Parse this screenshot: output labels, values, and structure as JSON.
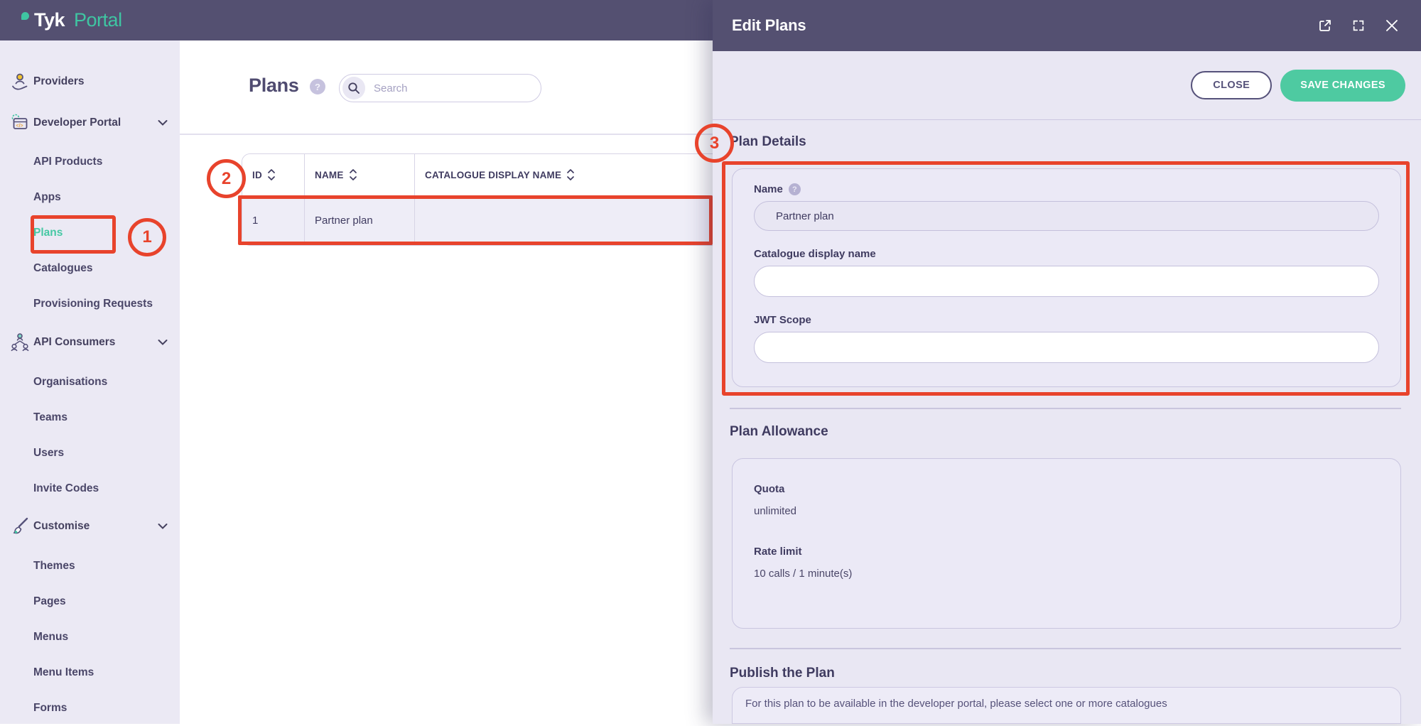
{
  "brand": {
    "name_primary": "Tyk",
    "name_secondary": "Portal"
  },
  "sidebar": {
    "items": [
      {
        "label": "Providers",
        "type": "section",
        "icon": "providers-icon"
      },
      {
        "label": "Developer Portal",
        "type": "section",
        "icon": "developer-portal-icon",
        "expanded": true
      },
      {
        "label": "API Products",
        "type": "child"
      },
      {
        "label": "Apps",
        "type": "child"
      },
      {
        "label": "Plans",
        "type": "child",
        "selected": true
      },
      {
        "label": "Catalogues",
        "type": "child"
      },
      {
        "label": "Provisioning Requests",
        "type": "child"
      },
      {
        "label": "API Consumers",
        "type": "section",
        "icon": "api-consumers-icon",
        "expanded": true
      },
      {
        "label": "Organisations",
        "type": "child"
      },
      {
        "label": "Teams",
        "type": "child"
      },
      {
        "label": "Users",
        "type": "child"
      },
      {
        "label": "Invite Codes",
        "type": "child"
      },
      {
        "label": "Customise",
        "type": "section",
        "icon": "customise-icon",
        "expanded": true
      },
      {
        "label": "Themes",
        "type": "child"
      },
      {
        "label": "Pages",
        "type": "child"
      },
      {
        "label": "Menus",
        "type": "child"
      },
      {
        "label": "Menu Items",
        "type": "child"
      },
      {
        "label": "Forms",
        "type": "child"
      }
    ]
  },
  "main": {
    "title": "Plans",
    "title_help": "?",
    "search": {
      "placeholder": "Search",
      "value": ""
    },
    "table": {
      "columns": [
        "ID",
        "NAME",
        "CATALOGUE DISPLAY NAME"
      ],
      "rows": [
        {
          "id": "1",
          "name": "Partner plan",
          "catalogue_display_name": ""
        }
      ]
    }
  },
  "drawer": {
    "title": "Edit Plans",
    "header_icons": [
      "open-in-new-window-icon",
      "fullscreen-icon",
      "close-icon"
    ],
    "buttons": {
      "close": "CLOSE",
      "save": "SAVE CHANGES"
    },
    "plan_details": {
      "heading": "Plan Details",
      "name_label": "Name",
      "name_help": "?",
      "name_value": "Partner plan",
      "catalogue_display_name_label": "Catalogue display name",
      "catalogue_display_name_value": "",
      "jwt_scope_label": "JWT Scope",
      "jwt_scope_value": ""
    },
    "plan_allowance": {
      "heading": "Plan Allowance",
      "quota_label": "Quota",
      "quota_value": "unlimited",
      "rate_limit_label": "Rate limit",
      "rate_limit_value": "10 calls / 1 minute(s)"
    },
    "publish": {
      "heading": "Publish the Plan",
      "description": "For this plan to be available in the developer portal, please select one or more catalogues"
    }
  },
  "annotations": {
    "step1": "1",
    "step2": "2",
    "step3": "3"
  },
  "colors": {
    "topbar": "#545071",
    "sidebar_bg": "#ebe9f4",
    "accent_teal": "#3fc5a2",
    "save_button": "#4ecaa1",
    "annotation_red": "#e8432c",
    "drawer_bg": "#e9e7f3"
  }
}
